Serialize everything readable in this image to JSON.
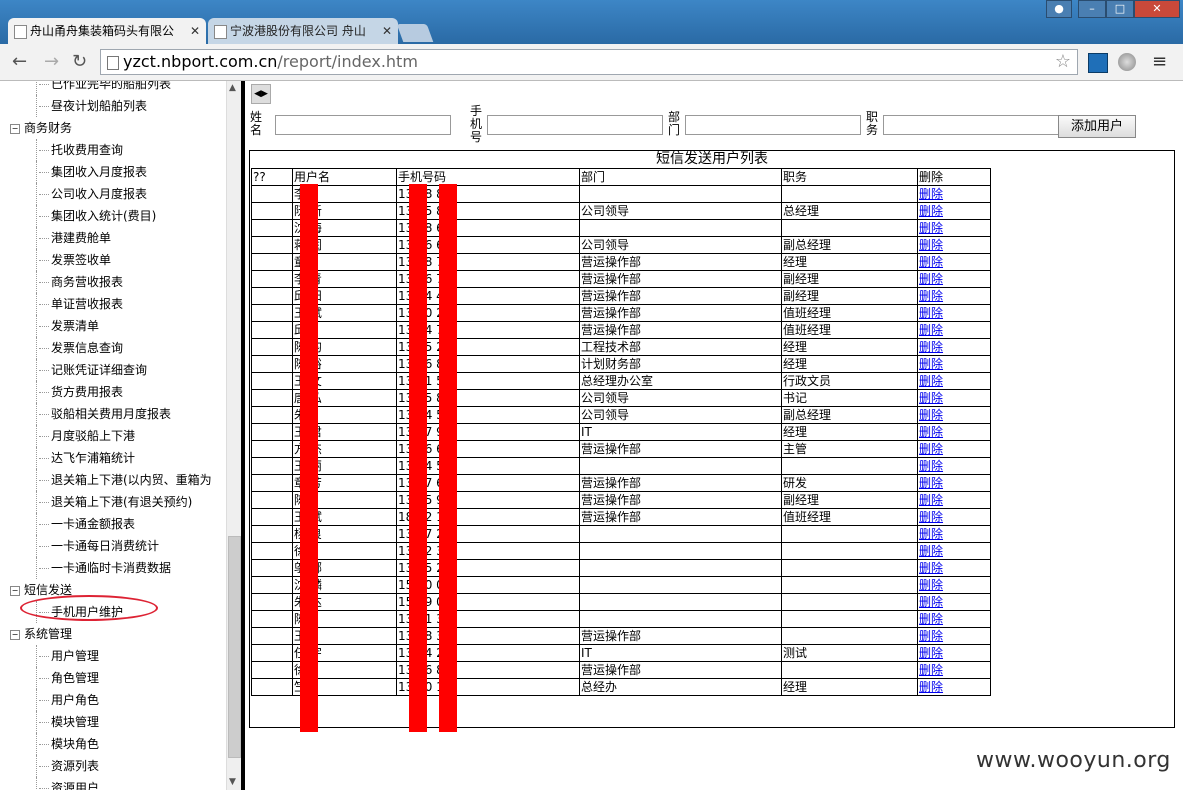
{
  "browser": {
    "tabs": [
      {
        "label": "舟山甬舟集装箱码头有限公"
      },
      {
        "label": "宁波港股份有限公司 舟山"
      }
    ],
    "url_host": "yzct.nbport.com.cn",
    "url_path": "/report/index.htm"
  },
  "sidebar": {
    "items": [
      {
        "type": "leaf",
        "label": "已作业完毕的船舶列表"
      },
      {
        "type": "leaf",
        "label": "昼夜计划船舶列表"
      },
      {
        "type": "group",
        "label": "商务财务"
      },
      {
        "type": "leaf",
        "label": "托收费用查询"
      },
      {
        "type": "leaf",
        "label": "集团收入月度报表"
      },
      {
        "type": "leaf",
        "label": "公司收入月度报表"
      },
      {
        "type": "leaf",
        "label": "集团收入统计(费目)"
      },
      {
        "type": "leaf",
        "label": "港建费舱单"
      },
      {
        "type": "leaf",
        "label": "发票签收单"
      },
      {
        "type": "leaf",
        "label": "商务营收报表"
      },
      {
        "type": "leaf",
        "label": "单证营收报表"
      },
      {
        "type": "leaf",
        "label": "发票清单"
      },
      {
        "type": "leaf",
        "label": "发票信息查询"
      },
      {
        "type": "leaf",
        "label": "记账凭证详细查询"
      },
      {
        "type": "leaf",
        "label": "货方费用报表"
      },
      {
        "type": "leaf",
        "label": "驳船相关费用月度报表"
      },
      {
        "type": "leaf",
        "label": "月度驳船上下港"
      },
      {
        "type": "leaf",
        "label": "达飞乍浦箱统计"
      },
      {
        "type": "leaf",
        "label": "退关箱上下港(以内贸、重箱为"
      },
      {
        "type": "leaf",
        "label": "退关箱上下港(有退关预约)"
      },
      {
        "type": "leaf",
        "label": "一卡通金额报表"
      },
      {
        "type": "leaf",
        "label": "一卡通每日消费统计"
      },
      {
        "type": "leaf",
        "label": "一卡通临时卡消费数据"
      },
      {
        "type": "group",
        "label": "短信发送"
      },
      {
        "type": "leaf",
        "label": "手机用户维护"
      },
      {
        "type": "group",
        "label": "系统管理"
      },
      {
        "type": "leaf",
        "label": "用户管理"
      },
      {
        "type": "leaf",
        "label": "角色管理"
      },
      {
        "type": "leaf",
        "label": "用户角色"
      },
      {
        "type": "leaf",
        "label": "模块管理"
      },
      {
        "type": "leaf",
        "label": "模块角色"
      },
      {
        "type": "leaf",
        "label": "资源列表"
      },
      {
        "type": "leaf",
        "label": "资源用户"
      }
    ]
  },
  "form": {
    "name_label": "姓名",
    "phone_label": "手机号",
    "dept_label": "部门",
    "title_label": "职务",
    "add_button": "添加用户"
  },
  "list": {
    "title": "短信发送用户列表",
    "headers": [
      "??",
      "用户名",
      "手机号码",
      "部门",
      "职务",
      "删除"
    ],
    "rows": [
      [
        "",
        "李",
        "13  78  86",
        "",
        "",
        "删除"
      ],
      [
        "",
        "阮  新",
        "13  85  83",
        "公司领导",
        "总经理",
        "删除"
      ],
      [
        "",
        "沈  海",
        "13  08  68",
        "",
        "",
        "删除"
      ],
      [
        "",
        "蒋  润",
        "13  36  66",
        "公司领导",
        "副总经理",
        "删除"
      ],
      [
        "",
        "童",
        "13  28  71",
        "营运操作部",
        "经理",
        "删除"
      ],
      [
        "",
        "李  青",
        "13  56  78",
        "营运操作部",
        "副经理",
        "删除"
      ],
      [
        "",
        "邱  阳",
        "13  74  44",
        "营运操作部",
        "副经理",
        "删除"
      ],
      [
        "",
        "王  斌",
        "13  40  28",
        "营运操作部",
        "值班经理",
        "删除"
      ],
      [
        "",
        "邱",
        "13  84  79",
        "营运操作部",
        "值班经理",
        "删除"
      ],
      [
        "",
        "陈  均",
        "13  85  28",
        "工程技术部",
        "经理",
        "删除"
      ],
      [
        "",
        "陈  裕",
        "13  46  89",
        "计划财务部",
        "经理",
        "删除"
      ],
      [
        "",
        "王  文",
        "13  11  52",
        "总经理办公室",
        "行政文员",
        "删除"
      ],
      [
        "",
        "唐  弘",
        "13  85  85",
        "公司领导",
        "书记",
        "删除"
      ],
      [
        "",
        "朱",
        "13  84  55",
        "公司领导",
        "副总经理",
        "删除"
      ],
      [
        "",
        "王  君",
        "13  07  90",
        "IT",
        "经理",
        "删除"
      ],
      [
        "",
        "方  杰",
        "13  86  62",
        "营运操作部",
        "主管",
        "删除"
      ],
      [
        "",
        "王  丽",
        "13  84  52",
        "",
        "",
        "删除"
      ],
      [
        "",
        "章  芳",
        "13  27  62",
        "营运操作部",
        "研发",
        "删除"
      ],
      [
        "",
        "陈",
        "13  45  97",
        "营运操作部",
        "副经理",
        "删除"
      ],
      [
        "",
        "王  斌",
        "18  22  11",
        "营运操作部",
        "值班经理",
        "删除"
      ],
      [
        "",
        "杨  良",
        "13  57  27",
        "",
        "",
        "删除"
      ],
      [
        "",
        "徐",
        "13  52  35",
        "",
        "",
        "删除"
      ],
      [
        "",
        "邬  娜",
        "13  05  20",
        "",
        "",
        "删除"
      ],
      [
        "",
        "沈  麟",
        "15  80  04",
        "",
        "",
        "删除"
      ],
      [
        "",
        "朱  达",
        "15  09  06",
        "",
        "",
        "删除"
      ],
      [
        "",
        "陈",
        "13  11  36",
        "",
        "",
        "删除"
      ],
      [
        "",
        "王",
        "13  08  36",
        "营运操作部",
        "",
        "删除"
      ],
      [
        "",
        "任  宇",
        "13  74  20",
        "IT",
        "测试",
        "删除"
      ],
      [
        "",
        "徐",
        "13  06  81",
        "营运操作部",
        "",
        "删除"
      ],
      [
        "",
        "竺",
        "13  00  10",
        "总经办",
        "经理",
        "删除"
      ]
    ]
  },
  "watermark": "www.wooyun.org",
  "colors": {
    "redaction": "#ff0000",
    "highlight_circle": "#dd2233",
    "link": "#0000ee"
  }
}
